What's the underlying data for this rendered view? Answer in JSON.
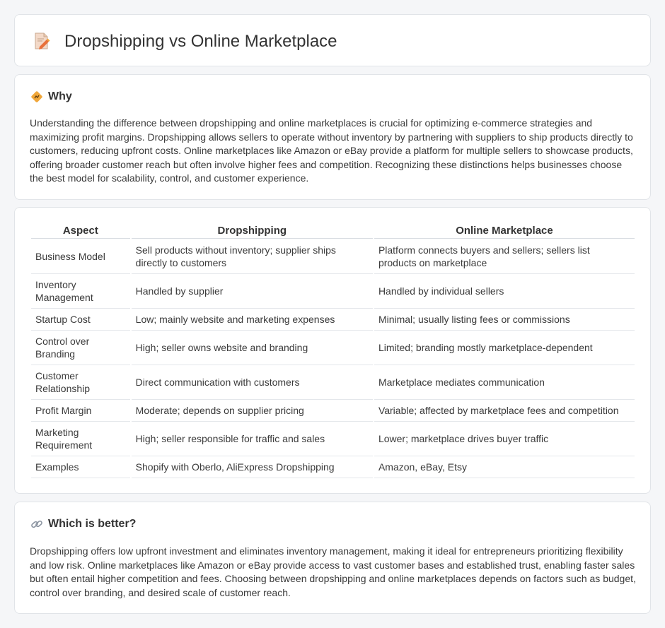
{
  "header": {
    "title": "Dropshipping vs Online Marketplace",
    "icon": "document-pencil-icon"
  },
  "why": {
    "heading": "Why",
    "icon": "warning-sign-icon",
    "text": "Understanding the difference between dropshipping and online marketplaces is crucial for optimizing e-commerce strategies and maximizing profit margins. Dropshipping allows sellers to operate without inventory by partnering with suppliers to ship products directly to customers, reducing upfront costs. Online marketplaces like Amazon or eBay provide a platform for multiple sellers to showcase products, offering broader customer reach but often involve higher fees and competition. Recognizing these distinctions helps businesses choose the best model for scalability, control, and customer experience."
  },
  "table": {
    "headers": [
      "Aspect",
      "Dropshipping",
      "Online Marketplace"
    ],
    "rows": [
      [
        "Business Model",
        "Sell products without inventory; supplier ships directly to customers",
        "Platform connects buyers and sellers; sellers list products on marketplace"
      ],
      [
        "Inventory Management",
        "Handled by supplier",
        "Handled by individual sellers"
      ],
      [
        "Startup Cost",
        "Low; mainly website and marketing expenses",
        "Minimal; usually listing fees or commissions"
      ],
      [
        "Control over Branding",
        "High; seller owns website and branding",
        "Limited; branding mostly marketplace-dependent"
      ],
      [
        "Customer Relationship",
        "Direct communication with customers",
        "Marketplace mediates communication"
      ],
      [
        "Profit Margin",
        "Moderate; depends on supplier pricing",
        "Variable; affected by marketplace fees and competition"
      ],
      [
        "Marketing Requirement",
        "High; seller responsible for traffic and sales",
        "Lower; marketplace drives buyer traffic"
      ],
      [
        "Examples",
        "Shopify with Oberlo, AliExpress Dropshipping",
        "Amazon, eBay, Etsy"
      ]
    ]
  },
  "better": {
    "heading": "Which is better?",
    "icon": "link-icon",
    "text": "Dropshipping offers low upfront investment and eliminates inventory management, making it ideal for entrepreneurs prioritizing flexibility and low risk. Online marketplaces like Amazon or eBay provide access to vast customer bases and established trust, enabling faster sales but often entail higher competition and fees. Choosing between dropshipping and online marketplaces depends on factors such as budget, control over branding, and desired scale of customer reach."
  },
  "colors": {
    "background": "#f5f6f8",
    "card": "#ffffff",
    "border": "#e1e4e8",
    "accent_orange": "#f0a73a"
  }
}
